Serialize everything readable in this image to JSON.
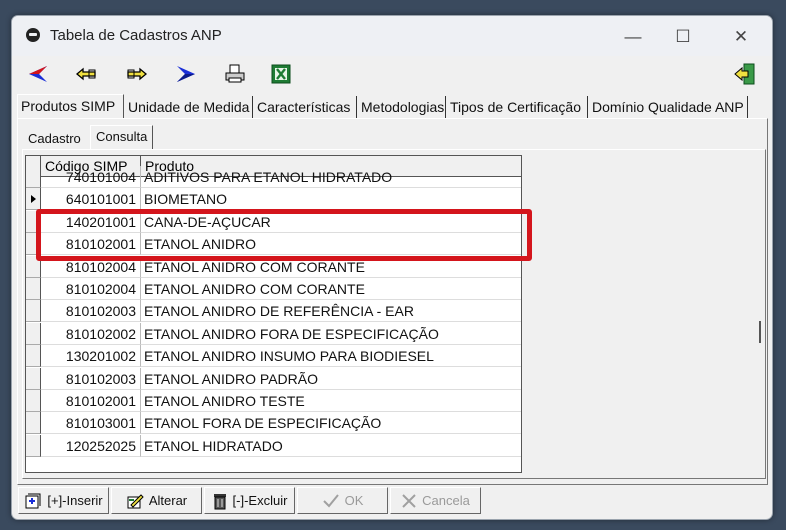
{
  "window": {
    "title": "Tabela de Cadastros ANP"
  },
  "title_controls": {
    "minimize": "—",
    "maximize": "☐",
    "close": "✕"
  },
  "toolbar": {
    "icons": [
      "first-record-icon",
      "previous-record-icon",
      "next-record-icon",
      "last-record-icon",
      "print-icon",
      "excel-export-icon",
      "exit-icon"
    ]
  },
  "main_tabs": [
    {
      "label": "Produtos SIMP",
      "active": true
    },
    {
      "label": "Unidade de Medida"
    },
    {
      "label": "Características"
    },
    {
      "label": "Metodologias"
    },
    {
      "label": "Tipos de Certificação"
    },
    {
      "label": "Domínio Qualidade ANP"
    }
  ],
  "sub_tabs": [
    {
      "label": "Cadastro"
    },
    {
      "label": "Consulta",
      "active": true
    }
  ],
  "grid": {
    "columns": [
      "Código SIMP",
      "Produto"
    ],
    "rows": [
      {
        "code": "740101004",
        "product": "ADITIVOS PARA ETANOL HIDRATADO"
      },
      {
        "code": "640101001",
        "product": "BIOMETANO",
        "current": true
      },
      {
        "code": "140201001",
        "product": "CANA-DE-AÇUCAR"
      },
      {
        "code": "810102001",
        "product": "ETANOL ANIDRO"
      },
      {
        "code": "810102004",
        "product": "ETANOL ANIDRO COM CORANTE"
      },
      {
        "code": "810102004",
        "product": "ETANOL ANIDRO COM CORANTE"
      },
      {
        "code": "810102003",
        "product": "ETANOL ANIDRO DE REFERÊNCIA - EAR"
      },
      {
        "code": "810102002",
        "product": "ETANOL ANIDRO FORA DE ESPECIFICAÇÃO"
      },
      {
        "code": "130201002",
        "product": "ETANOL ANIDRO INSUMO PARA BIODIESEL"
      },
      {
        "code": "810102003",
        "product": "ETANOL ANIDRO PADRÃO"
      },
      {
        "code": "810102001",
        "product": "ETANOL ANIDRO TESTE"
      },
      {
        "code": "810103001",
        "product": "ETANOL FORA DE ESPECIFICAÇÃO"
      },
      {
        "code": "120252025",
        "product": "ETANOL HIDRATADO"
      }
    ]
  },
  "buttons": {
    "insert": "[+]-Inserir",
    "edit": "Alterar",
    "delete": "[-]-Excluir",
    "ok": "OK",
    "cancel": "Cancela"
  },
  "colors": {
    "highlight": "#d4151c",
    "nav_blue": "#1a2ed8"
  }
}
